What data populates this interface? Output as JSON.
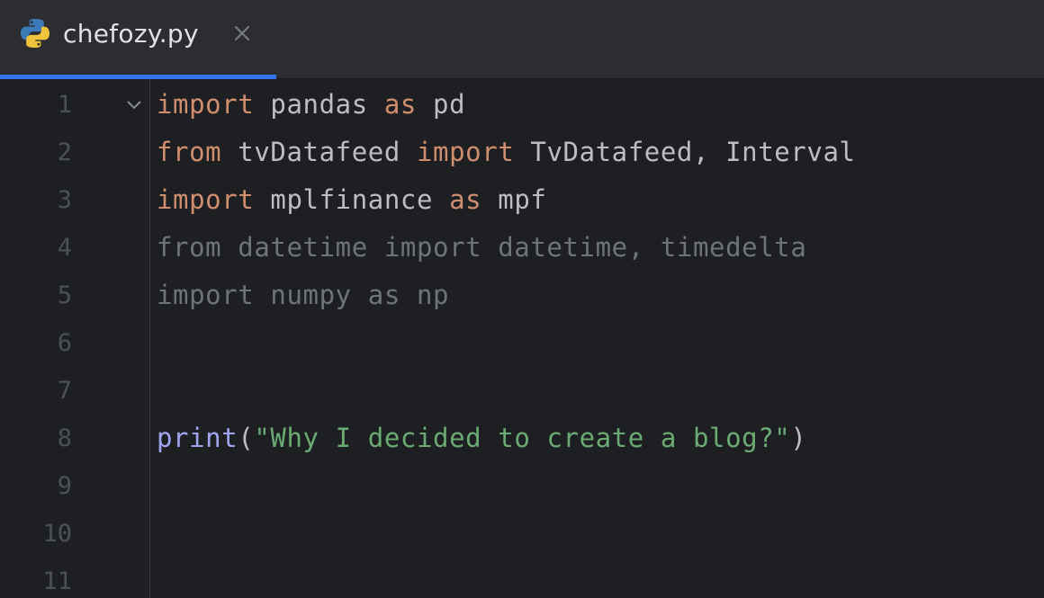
{
  "tab": {
    "filename": "chefozy.py",
    "close_symbol": "✕",
    "accent_color": "#3574f0",
    "icon": "python-icon"
  },
  "editor": {
    "lines": [
      {
        "number": "1",
        "has_fold": true,
        "tokens": [
          {
            "text": "import",
            "kind": "kw"
          },
          {
            "text": " pandas ",
            "kind": "txt"
          },
          {
            "text": "as",
            "kind": "kw"
          },
          {
            "text": " pd",
            "kind": "txt"
          }
        ]
      },
      {
        "number": "2",
        "has_fold": false,
        "tokens": [
          {
            "text": "from",
            "kind": "kw"
          },
          {
            "text": " tvDatafeed ",
            "kind": "txt"
          },
          {
            "text": "import",
            "kind": "kw"
          },
          {
            "text": " TvDatafeed, Interval",
            "kind": "txt"
          }
        ]
      },
      {
        "number": "3",
        "has_fold": false,
        "tokens": [
          {
            "text": "import",
            "kind": "kw"
          },
          {
            "text": " mplfinance ",
            "kind": "txt"
          },
          {
            "text": "as",
            "kind": "kw"
          },
          {
            "text": " mpf",
            "kind": "txt"
          }
        ]
      },
      {
        "number": "4",
        "has_fold": false,
        "tokens": [
          {
            "text": "from datetime import datetime, timedelta",
            "kind": "dim"
          }
        ]
      },
      {
        "number": "5",
        "has_fold": false,
        "tokens": [
          {
            "text": "import numpy as np",
            "kind": "dim"
          }
        ]
      },
      {
        "number": "6",
        "has_fold": false,
        "tokens": []
      },
      {
        "number": "7",
        "has_fold": false,
        "tokens": []
      },
      {
        "number": "8",
        "has_fold": false,
        "tokens": [
          {
            "text": "print",
            "kind": "fn"
          },
          {
            "text": "(",
            "kind": "txt"
          },
          {
            "text": "\"Why I decided to create a blog?\"",
            "kind": "str"
          },
          {
            "text": ")",
            "kind": "txt"
          }
        ]
      },
      {
        "number": "9",
        "has_fold": false,
        "tokens": []
      },
      {
        "number": "10",
        "has_fold": false,
        "tokens": []
      },
      {
        "number": "11",
        "has_fold": false,
        "tokens": []
      }
    ]
  },
  "colors": {
    "background": "#1e1f22",
    "tabbar": "#2b2d30",
    "keyword": "#cf8e6d",
    "text": "#bcbec4",
    "function": "#a0a5f0",
    "string": "#6aab73",
    "unused_import": "#6f737a",
    "line_number": "#4b5059"
  }
}
